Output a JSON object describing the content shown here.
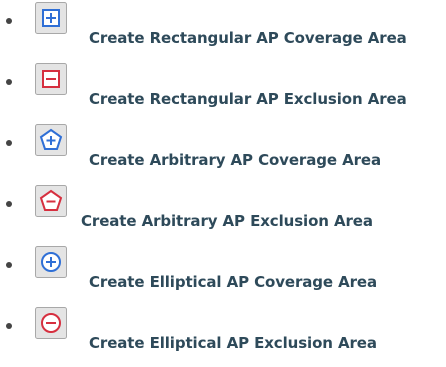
{
  "items": [
    {
      "icon": "rectangle-plus-icon",
      "label": "Create Rectangular AP Coverage Area"
    },
    {
      "icon": "rectangle-minus-icon",
      "label": "Create Rectangular AP Exclusion Area"
    },
    {
      "icon": "pentagon-plus-icon",
      "label": "Create Arbitrary AP Coverage Area"
    },
    {
      "icon": "pentagon-minus-icon",
      "label": "Create Arbitrary AP Exclusion Area"
    },
    {
      "icon": "circle-plus-icon",
      "label": "Create Elliptical AP Coverage Area"
    },
    {
      "icon": "circle-minus-icon",
      "label": "Create Elliptical AP Exclusion Area"
    }
  ],
  "colors": {
    "text": "#2e4a5a",
    "coverage": "#2f6fd6",
    "exclusion": "#d62f3f",
    "button_face": "#e4e4e4",
    "button_border": "#a8a8a8"
  }
}
